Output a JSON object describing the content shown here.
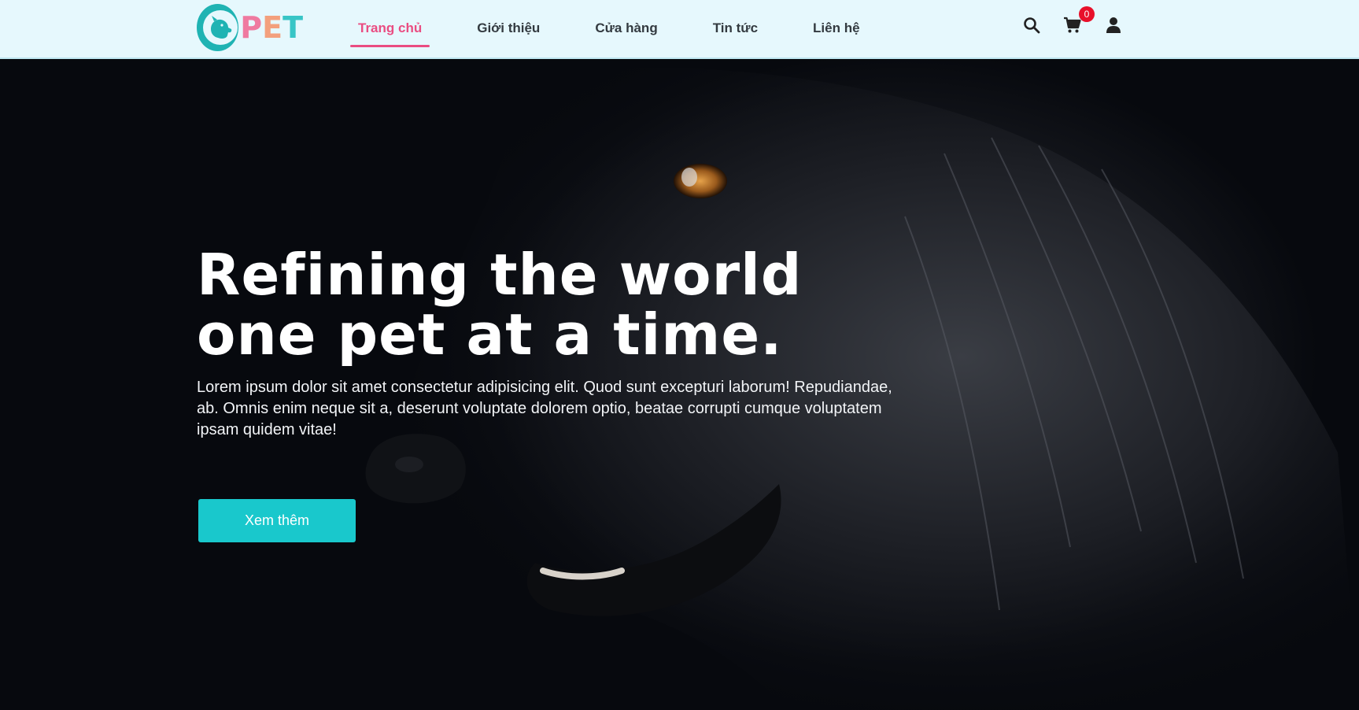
{
  "brand": {
    "logo_text": "PET",
    "colors": {
      "teal": "#1fb3b3",
      "pink": "#ef7aa0",
      "peach": "#f3a07d"
    }
  },
  "nav": {
    "items": [
      {
        "label": "Trang chủ",
        "active": true
      },
      {
        "label": "Giới thiệu",
        "active": false
      },
      {
        "label": "Cửa hàng",
        "active": false
      },
      {
        "label": "Tin tức",
        "active": false
      },
      {
        "label": "Liên hệ",
        "active": false
      }
    ],
    "active_color": "#ea4d82"
  },
  "header_icons": {
    "search": "search-icon",
    "cart": "cart-icon",
    "account": "user-icon",
    "cart_count": "0"
  },
  "hero": {
    "title": "Refining the world one pet at a time.",
    "description": "Lorem ipsum dolor sit amet consectetur adipisicing elit. Quod sunt excepturi laborum! Repudiandae, ab. Omnis enim neque sit a, deserunt voluptate dolorem optio, beatae corrupti cumque voluptatem ipsam quidem vitae!",
    "cta_label": "Xem thêm",
    "cta_color": "#19c8cc",
    "background_image": "black-dog-photo"
  }
}
